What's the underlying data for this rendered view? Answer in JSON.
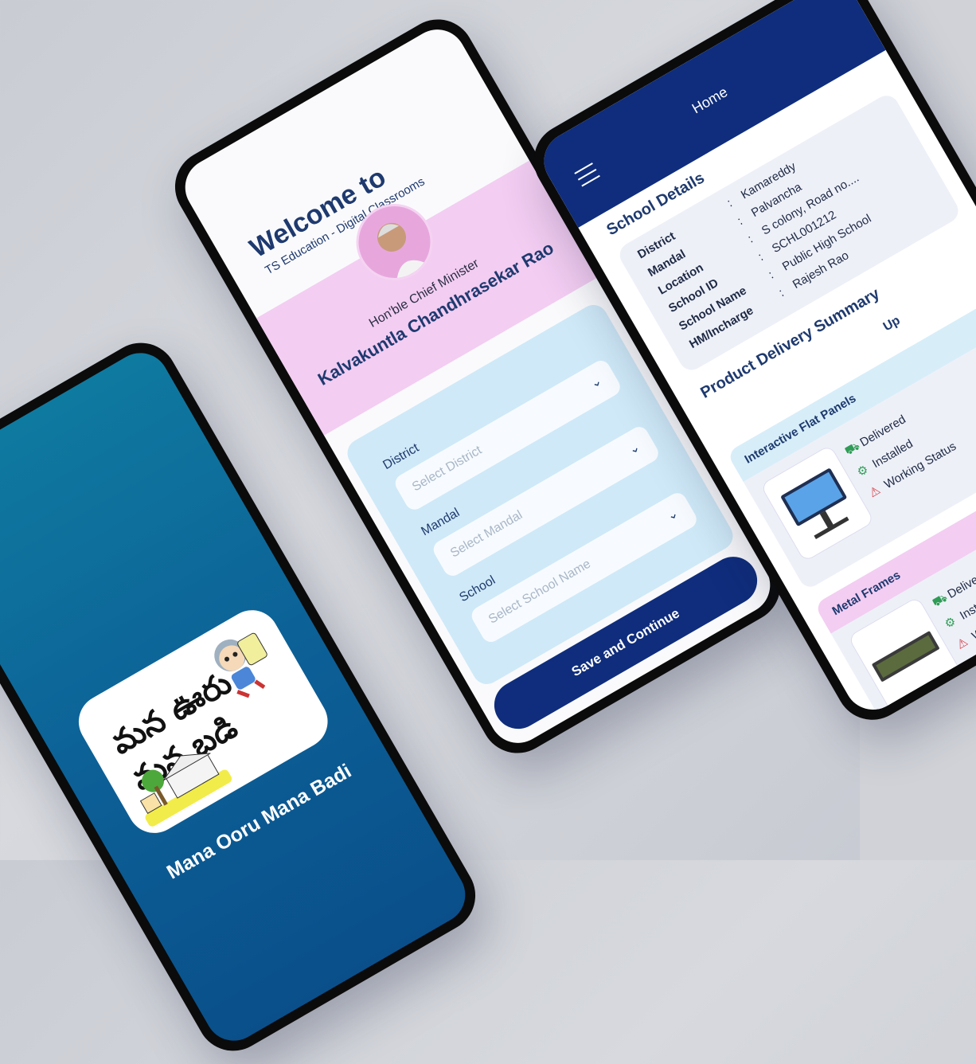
{
  "splash": {
    "logo_script": "మన ఊరు మన బడి",
    "app_title": "Mana Ooru Mana Badi"
  },
  "welcome": {
    "title": "Welcome to",
    "subtitle": "TS Education - Digital Classrooms",
    "cm_role": "Hon'ble Chief Minister",
    "cm_name": "Kalvakuntla Chandhrasekar Rao",
    "fields": {
      "district_label": "District",
      "district_placeholder": "Select District",
      "mandal_label": "Mandal",
      "mandal_placeholder": "Select Mandal",
      "school_label": "School",
      "school_placeholder": "Select School Name"
    },
    "button_label": "Save and Continue"
  },
  "home": {
    "title": "Home",
    "school_details_title": "School  Details",
    "details": [
      {
        "key": "District",
        "value": "Kamareddy"
      },
      {
        "key": "Mandal",
        "value": "Palvancha"
      },
      {
        "key": "Location",
        "value": "S colony, Road no...."
      },
      {
        "key": "School ID",
        "value": "SCHL001212"
      },
      {
        "key": "School Name",
        "value": "Public High School"
      },
      {
        "key": "HM/Incharge",
        "value": "Rajesh Rao"
      }
    ],
    "delivery_title": "Product Delivery Summary",
    "tab_active": "",
    "tab_other": "Up",
    "products": [
      {
        "name": "Interactive Flat Panels",
        "statuses": [
          "Delivered",
          "Installed",
          "Working Status"
        ],
        "head_color": "#d7eef9"
      },
      {
        "name": "Metal Frames",
        "statuses": [
          "Delivered",
          "Installed",
          "Working Status"
        ],
        "head_color": "#f3cdf2"
      }
    ]
  },
  "colors": {
    "navy": "#0f2d7c",
    "splash_blue": "#0c5f96",
    "pink": "#f3cdf2",
    "light_blue": "#cfe9f8"
  }
}
